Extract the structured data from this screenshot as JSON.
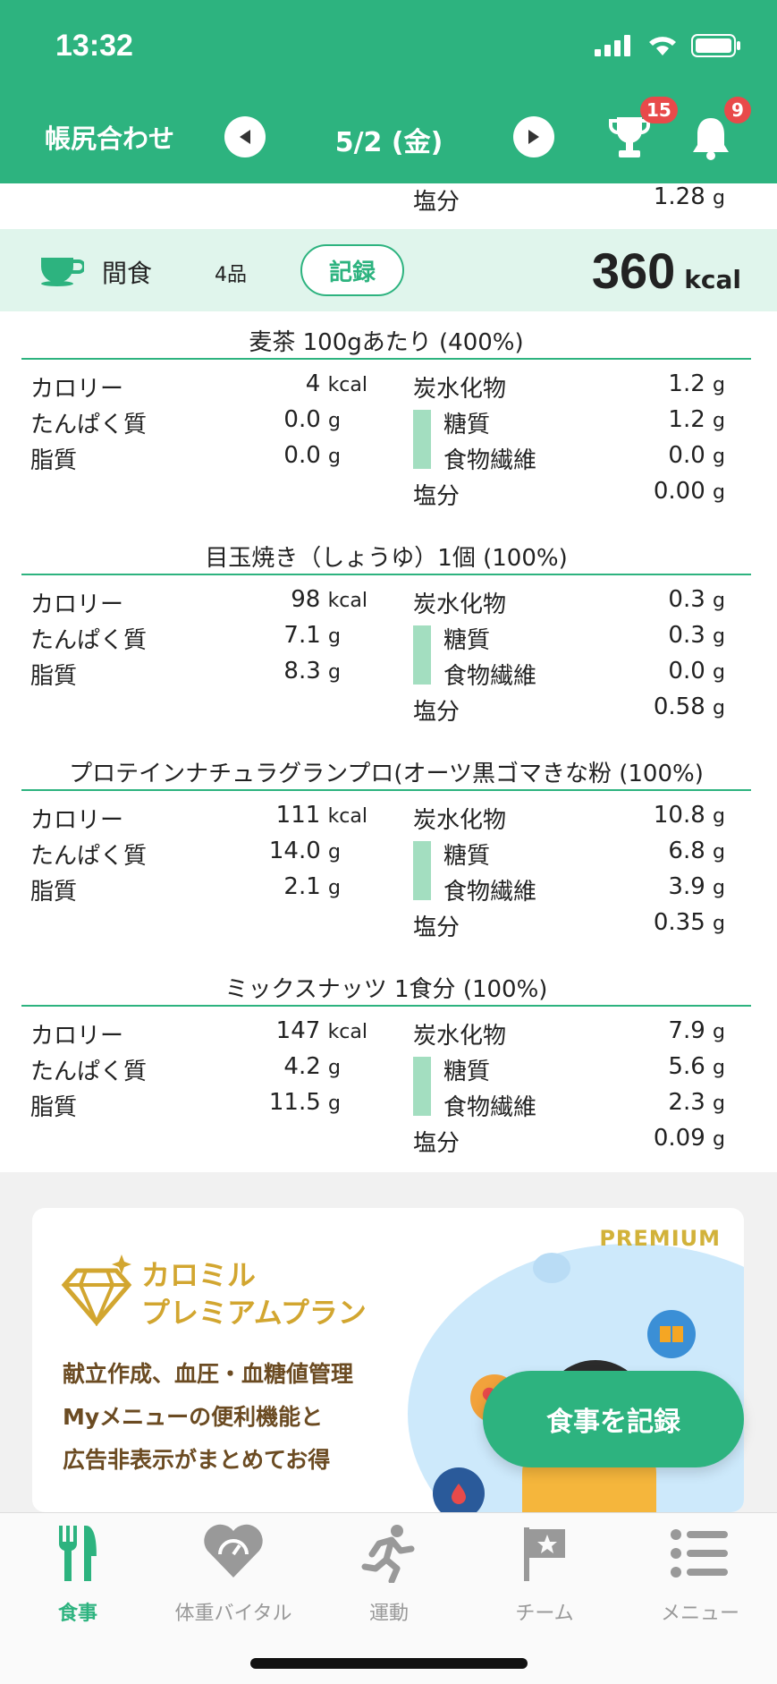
{
  "status_bar": {
    "time": "13:32"
  },
  "header": {
    "title": "帳尻合わせ",
    "date": "5/2 (金)",
    "trophy_badge": "15",
    "bell_badge": "9",
    "bg_color": "#2db37f"
  },
  "prev_salt": {
    "label": "塩分",
    "value": "1.28",
    "unit": "g"
  },
  "snack": {
    "label": "間食",
    "count": "4品",
    "record_label": "記録",
    "kcal": "360",
    "kcal_unit": "kcal"
  },
  "items": [
    {
      "title": "麦茶 100gあたり  (400%)",
      "calories": "4",
      "protein": "0.0",
      "fat": "0.0",
      "carbs": "1.2",
      "sugar": "1.2",
      "fiber": "0.0",
      "salt": "0.00"
    },
    {
      "title": "目玉焼き（しょうゆ）1個  (100%)",
      "calories": "98",
      "protein": "7.1",
      "fat": "8.3",
      "carbs": "0.3",
      "sugar": "0.3",
      "fiber": "0.0",
      "salt": "0.58"
    },
    {
      "title": "プロテインナチュラグランプロ(オーツ黒ゴマきな粉  (100%)",
      "calories": "111",
      "protein": "14.0",
      "fat": "2.1",
      "carbs": "10.8",
      "sugar": "6.8",
      "fiber": "3.9",
      "salt": "0.35"
    },
    {
      "title": "ミックスナッツ 1食分  (100%)",
      "calories": "147",
      "protein": "4.2",
      "fat": "11.5",
      "carbs": "7.9",
      "sugar": "5.6",
      "fiber": "2.3",
      "salt": "0.09"
    }
  ],
  "labels": {
    "calories": "カロリー",
    "protein": "たんぱく質",
    "fat": "脂質",
    "carbs": "炭水化物",
    "sugar": "糖質",
    "fiber": "食物繊維",
    "salt": "塩分",
    "kcal": "kcal",
    "g": "g"
  },
  "promo": {
    "premium": "PREMIUM",
    "title_1": "カロミル",
    "title_2": "プレミアムプラン",
    "line_1": "献立作成、血圧・血糖値管理",
    "line_2": "Myメニューの便利機能と",
    "line_3": "広告非表示がまとめてお得"
  },
  "cta": {
    "label": "食事を記録"
  },
  "tabs": [
    {
      "label": "食事",
      "icon": "fork-knife-icon",
      "active": true
    },
    {
      "label": "体重バイタル",
      "icon": "heart-scale-icon",
      "active": false
    },
    {
      "label": "運動",
      "icon": "runner-icon",
      "active": false
    },
    {
      "label": "チーム",
      "icon": "flag-icon",
      "active": false
    },
    {
      "label": "メニュー",
      "icon": "list-icon",
      "active": false
    }
  ],
  "colors": {
    "accent": "#2db37f",
    "active_tab": "#2db37f",
    "inactive_tab": "#999999",
    "badge": "#e84a4a"
  }
}
